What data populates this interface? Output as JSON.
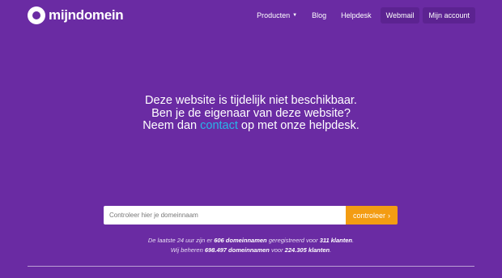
{
  "brand": {
    "name": "mijndomein"
  },
  "nav": {
    "items": [
      {
        "label": "Producten",
        "icon": "caret-down-icon"
      },
      {
        "label": "Blog"
      },
      {
        "label": "Helpdesk"
      },
      {
        "label": "Webmail"
      },
      {
        "label": "Mijn account"
      }
    ]
  },
  "message": {
    "line1": "Deze website is tijdelijk niet beschikbaar.",
    "line2": "Ben je de eigenaar van deze website?",
    "line3_prefix": "Neem dan ",
    "line3_link": "contact",
    "line3_suffix": " op met onze helpdesk."
  },
  "search": {
    "placeholder": "Controleer hier je domeinnaam",
    "button_label": "controleer",
    "button_icon": "chevron-right-icon"
  },
  "stats": {
    "line1": {
      "t1": "De laatste 24 uur zijn er ",
      "domains_count": "606 domeinnamen",
      "t2": " geregistreerd voor ",
      "customers_count": "311 klanten",
      "t3": "."
    },
    "line2": {
      "t1": "Wij beheren ",
      "domains_count": "698.497 domeinnamen",
      "t2": " voor ",
      "customers_count": "224.305 klanten",
      "t3": "."
    }
  },
  "colors": {
    "background": "#6a2ba3",
    "accent_orange": "#f39c12",
    "link_blue": "#29b5e8"
  }
}
